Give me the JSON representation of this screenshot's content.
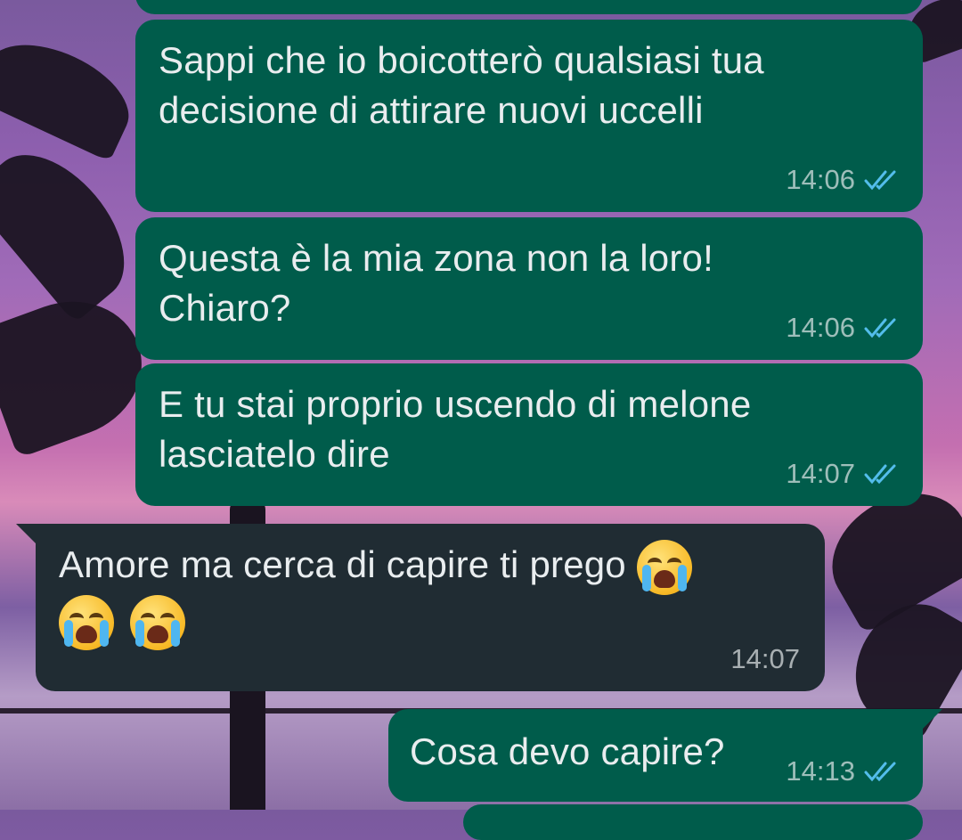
{
  "messages": [
    {
      "direction": "out",
      "text": "Sappi che io boicotterò qualsiasi tua decisione di attirare nuovi uccelli",
      "time": "14:06",
      "status": "read"
    },
    {
      "direction": "out",
      "text": "Questa è la mia zona non la loro! Chiaro?",
      "time": "14:06",
      "status": "read"
    },
    {
      "direction": "out",
      "text": "E tu stai proprio uscendo di melone lasciatelo dire",
      "time": "14:07",
      "status": "read"
    },
    {
      "direction": "in",
      "text": "Amore ma cerca di capire ti prego",
      "emoji": [
        "loudly-crying-face",
        "loudly-crying-face",
        "loudly-crying-face"
      ],
      "time": "14:07"
    },
    {
      "direction": "out",
      "text": "Cosa devo capire?",
      "time": "14:13",
      "status": "read"
    }
  ],
  "colors": {
    "outgoing_bubble": "#005c4b",
    "incoming_bubble": "#202c33",
    "read_ticks": "#53bdeb",
    "message_text": "#e9edef"
  }
}
